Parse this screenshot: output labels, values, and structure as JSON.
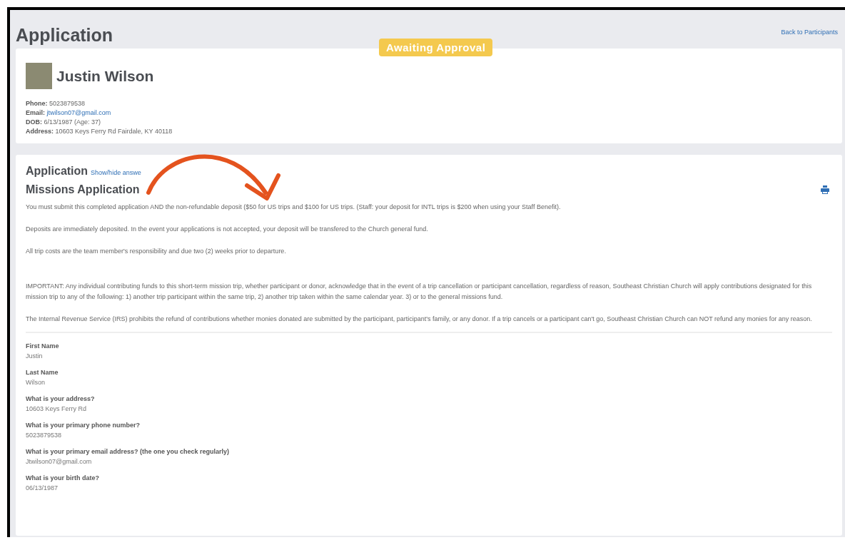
{
  "page": {
    "title": "Application",
    "back_link": "Back to Participants",
    "status_badge": "Awaiting Approval"
  },
  "participant": {
    "name": "Justin Wilson",
    "details": [
      {
        "label": "Phone:",
        "value": "5023879538",
        "kind": "text"
      },
      {
        "label": "Email:",
        "value": "jtwilson07@gmail.com",
        "kind": "link"
      },
      {
        "label": "DOB:",
        "value": "6/13/1987 (Age: 37)",
        "kind": "text"
      },
      {
        "label": "Address:",
        "value": "10603 Keys Ferry Rd Fairdale, KY 40118",
        "kind": "text"
      }
    ]
  },
  "application": {
    "heading": "Application",
    "toggle_link": "Show/hide answe",
    "form_title": "Missions Application",
    "paragraphs": [
      "You must submit this completed application AND the non-refundable deposit ($50 for US trips and $100 for US trips. (Staff: your deposit for INTL trips is $200 when using your Staff Benefit).",
      "Deposits are immediately deposited. In the event your applications is not accepted, your deposit will be transfered to the Church general fund.",
      "All trip costs are the team member's responsibility and due two (2) weeks prior to departure.",
      "IMPORTANT: Any individual contributing funds to this short-term mission trip, whether participant or donor, acknowledge that in the event of a trip cancellation or participant cancellation, regardless of reason, Southeast Christian Church will apply contributions designated for this mission trip to any of the following: 1) another trip participant within the same trip, 2) another trip taken within the same calendar year. 3) or to the general missions fund.",
      "The Internal Revenue Service (IRS) prohibits the refund of contributions whether monies donated are submitted by the participant, participant's family, or any donor. If a trip cancels or a participant can't go, Southeast Christian Church can NOT refund any monies for any reason."
    ],
    "answers": [
      {
        "question": "First Name",
        "answer": "Justin"
      },
      {
        "question": "Last Name",
        "answer": "Wilson"
      },
      {
        "question": "What is your address?",
        "answer": "10603 Keys Ferry Rd"
      },
      {
        "question": "What is your primary phone number?",
        "answer": "5023879538"
      },
      {
        "question": "What is your primary email address? (the one you check regularly)",
        "answer": "Jtwilson07@gmail.com"
      },
      {
        "question": "What is your birth date?",
        "answer": "06/13/1987"
      }
    ]
  }
}
